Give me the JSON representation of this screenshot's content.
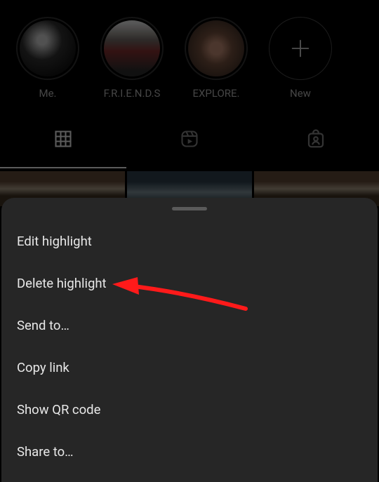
{
  "highlights": {
    "items": [
      {
        "label": "Me."
      },
      {
        "label": "F.R.I.E.N.D.S"
      },
      {
        "label": "EXPLORE."
      }
    ],
    "new_label": "New"
  },
  "tabs": {
    "grid_icon": "grid",
    "reels_icon": "reels",
    "tagged_icon": "tagged"
  },
  "sheet": {
    "items": {
      "edit": "Edit highlight",
      "delete": "Delete highlight",
      "send": "Send to…",
      "copy": "Copy link",
      "qr": "Show QR code",
      "share": "Share to…"
    }
  },
  "annotation": {
    "arrow_color": "#ff1a1a"
  }
}
